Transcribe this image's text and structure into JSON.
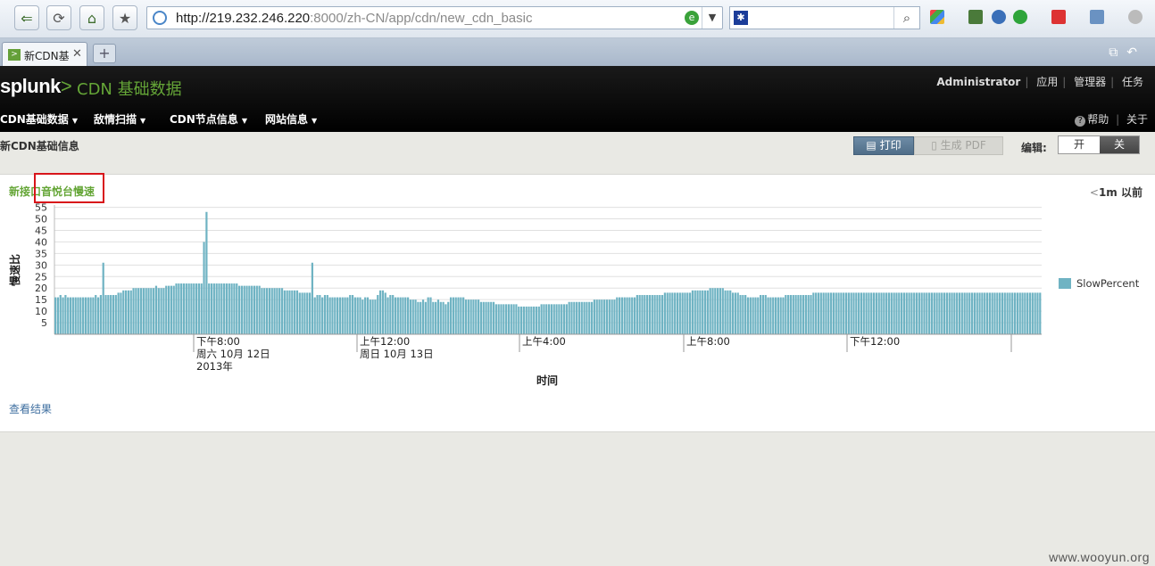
{
  "browser": {
    "url_host": "http://219.232.246.220",
    "url_rest": ":8000/zh-CN/app/cdn/new_cdn_basic",
    "tab_title": "新CDN基"
  },
  "header": {
    "logo_text": "splunk",
    "logo_arrow": ">",
    "app_title": "CDN 基础数据",
    "user_nav": [
      "Administrator",
      "应用",
      "管理器",
      "任务"
    ],
    "main_nav": [
      "CDN基础数据",
      "敌情扫描",
      "CDN节点信息",
      "网站信息"
    ],
    "help_label": "帮助",
    "about_label": "关于"
  },
  "page": {
    "title": "新CDN基础信息",
    "print_label": "打印",
    "pdf_label": "生成 PDF",
    "edit_label": "编辑:",
    "edit_on": "开",
    "edit_off": "关"
  },
  "panel": {
    "title": "新接口音悦台慢速",
    "ago_prefix": "<",
    "ago_text": "1m 以前",
    "view_results": "查看结果"
  },
  "chart_data": {
    "type": "bar",
    "ylabel": "慢速比",
    "xlabel": "时间",
    "ylim": [
      0,
      56
    ],
    "yticks": [
      5,
      10,
      15,
      20,
      25,
      30,
      35,
      40,
      45,
      50,
      55
    ],
    "grid": true,
    "legend_position": "right",
    "series": [
      {
        "name": "SlowPercent",
        "color": "#6fb3c3",
        "values": [
          16,
          16,
          17,
          16,
          17,
          16,
          16,
          16,
          16,
          16,
          16,
          16,
          16,
          16,
          16,
          16,
          17,
          16,
          17,
          31,
          17,
          17,
          17,
          17,
          17,
          18,
          18,
          19,
          19,
          19,
          19,
          20,
          20,
          20,
          20,
          20,
          20,
          20,
          20,
          20,
          21,
          20,
          20,
          20,
          21,
          21,
          21,
          21,
          22,
          22,
          22,
          22,
          22,
          22,
          22,
          22,
          22,
          22,
          22,
          40,
          53,
          22,
          22,
          22,
          22,
          22,
          22,
          22,
          22,
          22,
          22,
          22,
          22,
          21,
          21,
          21,
          21,
          21,
          21,
          21,
          21,
          21,
          20,
          20,
          20,
          20,
          20,
          20,
          20,
          20,
          20,
          19,
          19,
          19,
          19,
          19,
          19,
          18,
          18,
          18,
          18,
          18,
          31,
          16,
          17,
          17,
          16,
          17,
          17,
          16,
          16,
          16,
          16,
          16,
          16,
          16,
          16,
          17,
          17,
          16,
          16,
          16,
          15,
          16,
          16,
          15,
          15,
          15,
          17,
          19,
          19,
          18,
          16,
          17,
          17,
          16,
          16,
          16,
          16,
          16,
          16,
          15,
          15,
          15,
          14,
          14,
          15,
          14,
          16,
          16,
          14,
          14,
          15,
          14,
          14,
          13,
          14,
          16,
          16,
          16,
          16,
          16,
          16,
          15,
          15,
          15,
          15,
          15,
          15,
          14,
          14,
          14,
          14,
          14,
          14,
          13,
          13,
          13,
          13,
          13,
          13,
          13,
          13,
          13,
          12,
          12,
          12,
          12,
          12,
          12,
          12,
          12,
          12,
          13,
          13,
          13,
          13,
          13,
          13,
          13,
          13,
          13,
          13,
          13,
          14,
          14,
          14,
          14,
          14,
          14,
          14,
          14,
          14,
          14,
          15,
          15,
          15,
          15,
          15,
          15,
          15,
          15,
          15,
          16,
          16,
          16,
          16,
          16,
          16,
          16,
          16,
          17,
          17,
          17,
          17,
          17,
          17,
          17,
          17,
          17,
          17,
          17,
          18,
          18,
          18,
          18,
          18,
          18,
          18,
          18,
          18,
          18,
          18,
          19,
          19,
          19,
          19,
          19,
          19,
          19,
          20,
          20,
          20,
          20,
          20,
          20,
          19,
          19,
          19,
          18,
          18,
          18,
          17,
          17,
          17,
          16,
          16,
          16,
          16,
          16,
          17,
          17,
          17,
          16,
          16,
          16,
          16,
          16,
          16,
          16,
          17,
          17,
          17,
          17,
          17,
          17,
          17,
          17,
          17,
          17,
          17,
          18,
          18,
          18,
          18,
          18,
          18,
          18,
          18,
          18,
          18,
          18,
          18,
          18,
          18,
          18,
          18,
          18,
          18,
          18,
          18,
          18,
          18,
          18,
          18,
          18,
          18,
          18,
          18,
          18,
          18,
          18,
          18,
          18,
          18,
          18,
          18,
          18,
          18,
          18,
          18,
          18,
          18,
          18,
          18,
          18,
          18,
          18,
          18,
          18,
          18,
          18,
          18,
          18,
          18,
          18,
          18,
          18,
          18,
          18,
          18,
          18,
          18,
          18,
          18,
          18,
          18,
          18,
          18,
          18,
          18,
          18,
          18,
          18,
          18,
          18,
          18,
          18,
          18,
          18,
          18,
          18,
          18,
          18,
          18,
          18,
          18,
          18,
          18,
          18,
          18,
          18
        ]
      }
    ],
    "x_ticks": [
      {
        "lines": [
          "下午8:00",
          "周六  10月  12日",
          "2013年"
        ]
      },
      {
        "lines": [
          "上午12:00",
          "周日  10月  13日"
        ]
      },
      {
        "lines": [
          "上午4:00"
        ]
      },
      {
        "lines": [
          "上午8:00"
        ]
      },
      {
        "lines": [
          "下午12:00"
        ]
      }
    ]
  },
  "watermark": "www.wooyun.org"
}
